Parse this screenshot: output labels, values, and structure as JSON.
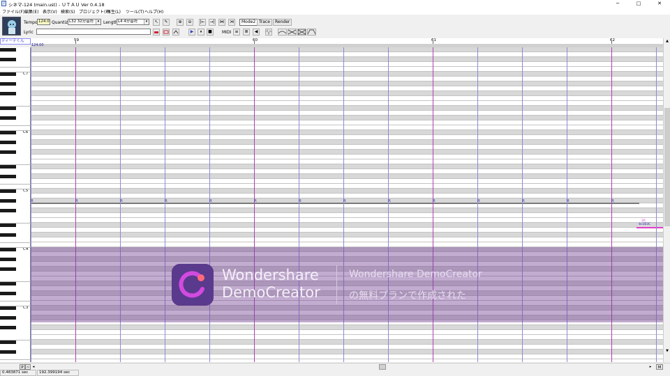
{
  "window": {
    "title": "シネマ-124 (main.ust) - ＵＴＡＵ Ver 0.4.18",
    "app_icon": "♪",
    "controls": [
      "─",
      "□",
      "✕"
    ]
  },
  "menu": [
    "ファイル(F)",
    "編集(E)",
    "表示(V)",
    "検索(S)",
    "プロジェクト(P)",
    "再生(L)",
    "ツール(T)",
    "ヘルプ(H)"
  ],
  "toolbar": {
    "tempo_label": "Tempo",
    "tempo_value": "124.0",
    "quantize_label": "Quantize",
    "quantize_value": "L32 32分音符",
    "length_label": "Length",
    "length_value": "L4  4分音符",
    "lyric_label": "Lyric",
    "lyric_value": "",
    "midi_label": "MIDI",
    "mode2_label": "Mode2",
    "trace_label": "Trace",
    "render_label": "Render"
  },
  "icons": {
    "arrow_tool": "↖",
    "pencil_tool": "✎",
    "zoom_in": "⊕",
    "zoom_out": "⊖",
    "goto_start": "|←",
    "goto_end": "→|",
    "split": "⋈",
    "merge": "⋊",
    "play": "▶",
    "pause": "⏸",
    "stop": "■",
    "midi_a": "≡",
    "midi_b": "≣",
    "midi_c": "◀"
  },
  "voicebank": "ディーテくん",
  "tempo_marker": "124.00",
  "ruler": {
    "bars": [
      "59",
      "60",
      "61",
      "62"
    ]
  },
  "piano": {
    "octaves": [
      "C7",
      "C6",
      "C5",
      "C4",
      "C3"
    ]
  },
  "notes": {
    "rest_label": "R",
    "count": 14,
    "pink_note_label": "-br2B3C",
    "pink_note_value": "26",
    "note_color": "#7a7a7a",
    "pink_color": "#e040c8"
  },
  "watermark": {
    "brand_line1": "Wondershare",
    "brand_line2": "DemoCreator",
    "text_line1": "Wondershare DemoCreator",
    "text_line2": "の無料プランで作成された"
  },
  "scroll": {
    "left_btn": "P",
    "btn2": "~",
    "btn3": "◂",
    "right_btn": "▸",
    "mode_btn": "M",
    "up": "▲",
    "down": "▼"
  },
  "status": {
    "time_left": "0.483871 sec",
    "time_total": "192.399194 sec"
  },
  "colors": {
    "bar_line": "#b040b0",
    "beat_line": "#8a8ad8",
    "watermark_overlay": "#784696"
  }
}
